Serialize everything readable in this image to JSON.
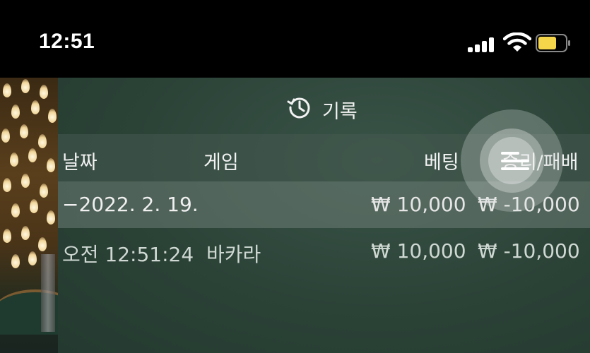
{
  "status_bar": {
    "time": "12:51",
    "icons": [
      "cellular-signal-icon",
      "wifi-icon",
      "battery-icon"
    ],
    "battery_color": "#f5d54a"
  },
  "panel": {
    "title": "기록",
    "icon": "history-icon",
    "columns": {
      "date": "날짜",
      "game": "게임",
      "bet": "베팅",
      "result": "승리/패배"
    },
    "date_row": {
      "date": "−2022. 2. 19.",
      "bet": "₩ 10,000",
      "result": "₩ -10,000"
    },
    "entries": [
      {
        "time": "오전 12:51:24",
        "game": "바카라",
        "bet": "₩ 10,000",
        "result": "₩ -10,000"
      }
    ]
  },
  "colors": {
    "panel_bg": "#2b4237",
    "header_row_bg": "#465a50",
    "date_row_bg": "#6e7d76"
  }
}
